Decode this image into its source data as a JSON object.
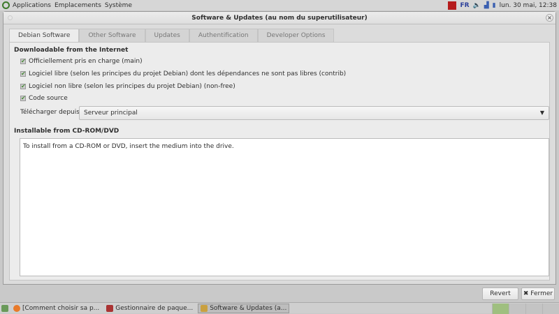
{
  "top_panel": {
    "menus": [
      "Applications",
      "Emplacements",
      "Système"
    ],
    "keyboard": "FR",
    "clock": "lun. 30 mai, 12:38"
  },
  "window": {
    "title": "Software & Updates (au nom du superutilisateur)",
    "close": "×"
  },
  "tabs": [
    "Debian Software",
    "Other Software",
    "Updates",
    "Authentification",
    "Developer Options"
  ],
  "internet": {
    "heading": "Downloadable from the Internet",
    "options": [
      {
        "label": "Officiellement pris en charge (main)",
        "checked": true
      },
      {
        "label": "Logiciel libre (selon les principes du projet Debian) dont les dépendances ne sont pas libres (contrib)",
        "checked": true
      },
      {
        "label": "Logiciel non libre (selon les principes du projet Debian) (non-free)",
        "checked": true
      },
      {
        "label": "Code source",
        "checked": true
      }
    ],
    "download_from_label": "Télécharger depuis :",
    "download_from_value": "Serveur principal"
  },
  "cdrom": {
    "heading": "Installable from CD-ROM/DVD",
    "text": "To install from a CD-ROM or DVD, insert the medium into the drive."
  },
  "buttons": {
    "revert": "Revert",
    "close": "✖ Fermer"
  },
  "taskbar": [
    "[Comment choisir sa p...",
    "Gestionnaire de paque...",
    "Software & Updates (a..."
  ]
}
